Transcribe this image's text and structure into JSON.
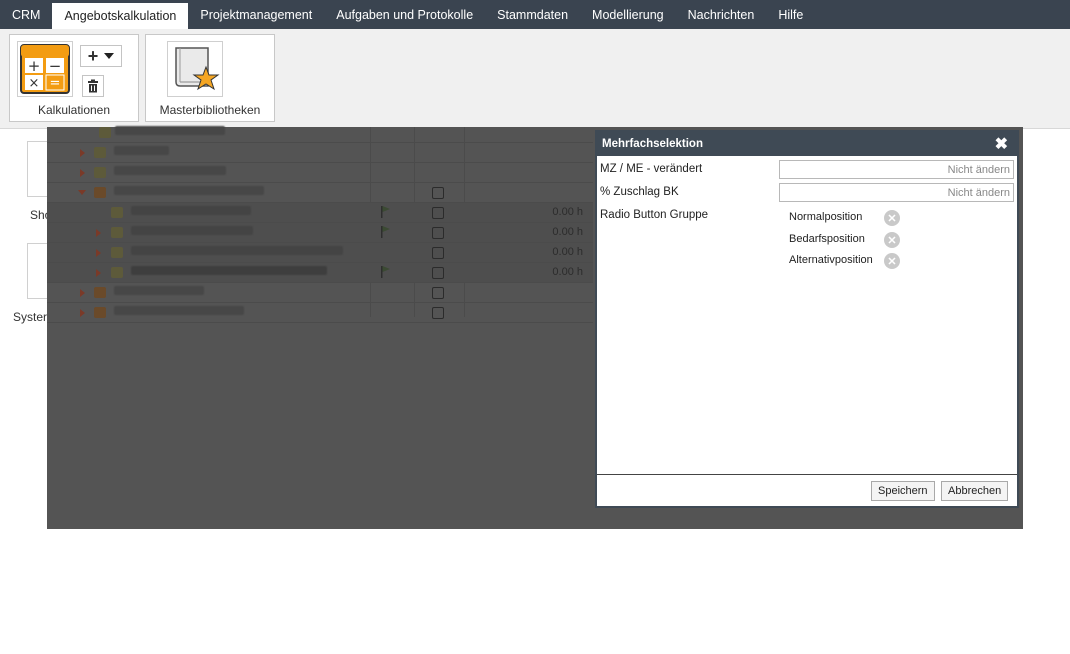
{
  "menu": {
    "items": [
      {
        "label": "CRM"
      },
      {
        "label": "Angebotskalkulation"
      },
      {
        "label": "Projektmanagement"
      },
      {
        "label": "Aufgaben und Protokolle"
      },
      {
        "label": "Stammdaten"
      },
      {
        "label": "Modellierung"
      },
      {
        "label": "Nachrichten"
      },
      {
        "label": "Hilfe"
      }
    ],
    "active": "Angebotskalkulation"
  },
  "ribbon": {
    "kalkulationen_label": "Kalkulationen",
    "masterbibliotheken_label": "Masterbibliotheken",
    "add_symbol": "+",
    "colors": {
      "calc_orange": "#f39c12",
      "star": "#f5a623"
    }
  },
  "background": {
    "label_1": "Sho",
    "label_2": "Syster",
    "tree_hours": [
      "0.00 h",
      "0.00 h",
      "0.00 h",
      "0.00 h"
    ]
  },
  "dialog": {
    "title": "Mehrfachselektion",
    "close_symbol": "✖",
    "fields": [
      {
        "label": "MZ / ME - verändert",
        "placeholder": "Nicht ändern"
      },
      {
        "label": "% Zuschlag BK",
        "placeholder": "Nicht ändern"
      }
    ],
    "radio_group_label": "Radio Button Gruppe",
    "radio_options": [
      "Normalposition",
      "Bedarfsposition",
      "Alternativposition"
    ],
    "save_label": "Speichern",
    "cancel_label": "Abbrechen"
  }
}
